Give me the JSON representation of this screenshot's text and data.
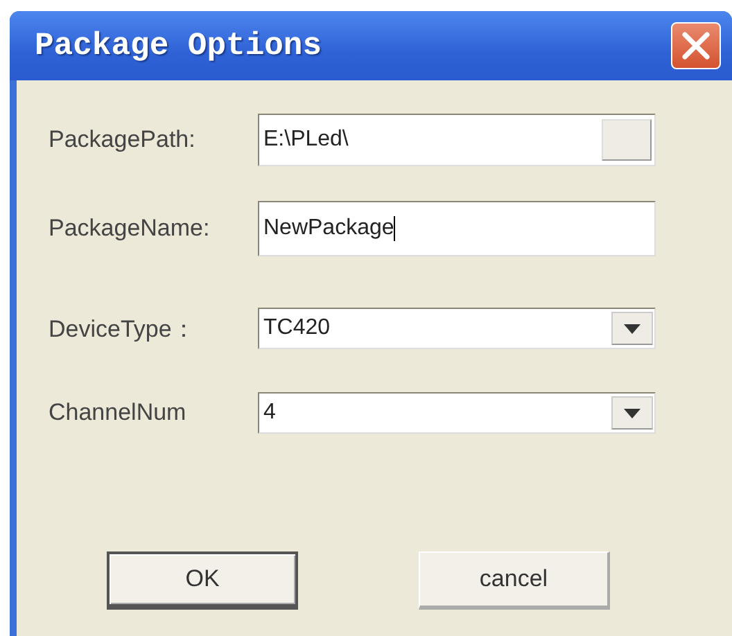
{
  "window": {
    "title": "Package Options"
  },
  "fields": [
    {
      "label": "PackagePath:",
      "kind": "browse",
      "value": "E:\\PLed\\",
      "focused": false
    },
    {
      "label": "PackageName:",
      "kind": "text",
      "value": "NewPackage",
      "focused": true
    },
    {
      "label": "DeviceType：",
      "kind": "combo",
      "value": "TC420",
      "focused": false
    },
    {
      "label": "ChannelNum",
      "kind": "combo",
      "value": "4",
      "focused": false
    }
  ],
  "buttons": [
    {
      "label": "OK",
      "default": true
    },
    {
      "label": "cancel",
      "default": false
    }
  ]
}
